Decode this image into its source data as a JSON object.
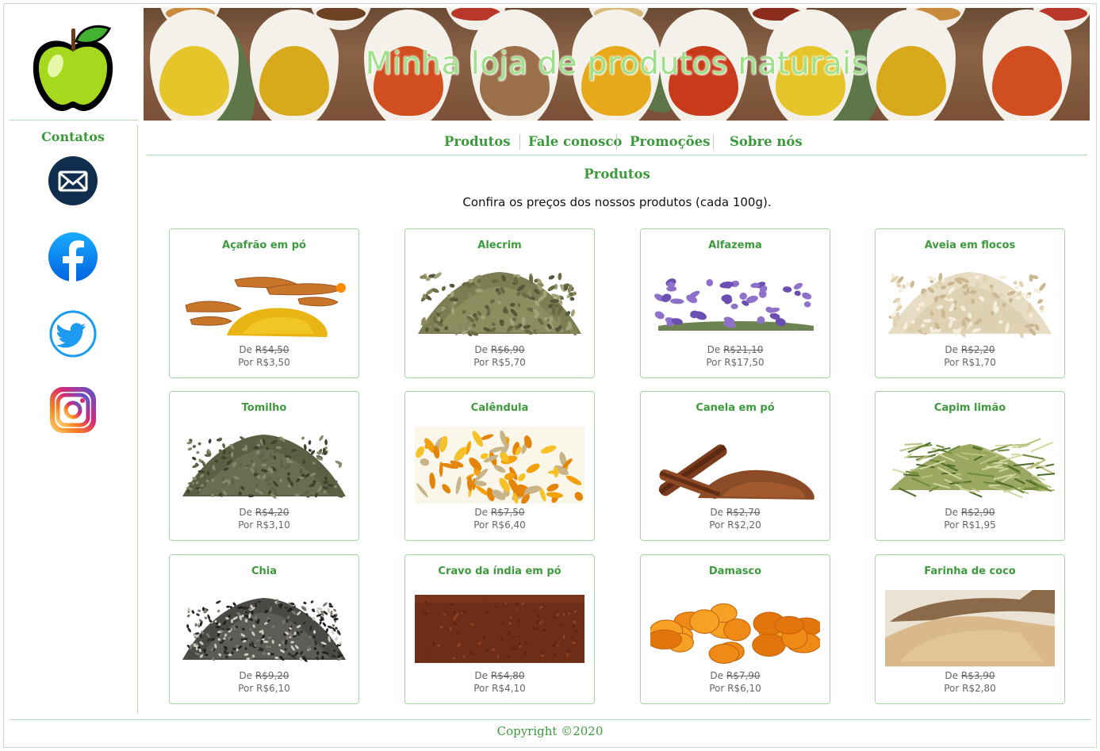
{
  "banner": {
    "title": "Minha loja de produtos naturais"
  },
  "sidebar": {
    "title": "Contatos",
    "icons": [
      "mail-icon",
      "facebook-icon",
      "twitter-icon",
      "instagram-icon"
    ]
  },
  "nav": {
    "items": [
      {
        "label": "Produtos"
      },
      {
        "label": "Fale conosco"
      },
      {
        "label": "Promoções"
      },
      {
        "label": "Sobre nós"
      }
    ]
  },
  "main": {
    "title": "Produtos",
    "intro": "Confira os preços dos nossos produtos (cada 100g).",
    "price_prefix_old": "De",
    "price_prefix_new": "Por",
    "products": [
      {
        "name": "Açafrão em pó",
        "old_price": "R$4,50",
        "new_price": "R$3,50",
        "image": "turmeric"
      },
      {
        "name": "Alecrim",
        "old_price": "R$6,90",
        "new_price": "R$5,70",
        "image": "rosemary"
      },
      {
        "name": "Alfazema",
        "old_price": "R$21,10",
        "new_price": "R$17,50",
        "image": "lavender"
      },
      {
        "name": "Aveia em flocos",
        "old_price": "R$2,20",
        "new_price": "R$1,70",
        "image": "oats"
      },
      {
        "name": "Tomilho",
        "old_price": "R$4,20",
        "new_price": "R$3,10",
        "image": "thyme"
      },
      {
        "name": "Calêndula",
        "old_price": "R$7,50",
        "new_price": "R$6,40",
        "image": "calendula"
      },
      {
        "name": "Canela em pó",
        "old_price": "R$2,70",
        "new_price": "R$2,20",
        "image": "cinnamon"
      },
      {
        "name": "Capim limão",
        "old_price": "R$2,90",
        "new_price": "R$1,95",
        "image": "lemongrass"
      },
      {
        "name": "Chia",
        "old_price": "R$9,20",
        "new_price": "R$6,10",
        "image": "chia"
      },
      {
        "name": "Cravo da índia em pó",
        "old_price": "R$4,80",
        "new_price": "R$4,10",
        "image": "clove"
      },
      {
        "name": "Damasco",
        "old_price": "R$7,90",
        "new_price": "R$6,10",
        "image": "apricot"
      },
      {
        "name": "Farinha de coco",
        "old_price": "R$3,90",
        "new_price": "R$2,80",
        "image": "coconut-flour"
      }
    ]
  },
  "footer": {
    "text": "Copyright ©2020"
  },
  "colors": {
    "accent": "#3c9a3c",
    "border": "#a9d2a9",
    "price": "#666666"
  }
}
